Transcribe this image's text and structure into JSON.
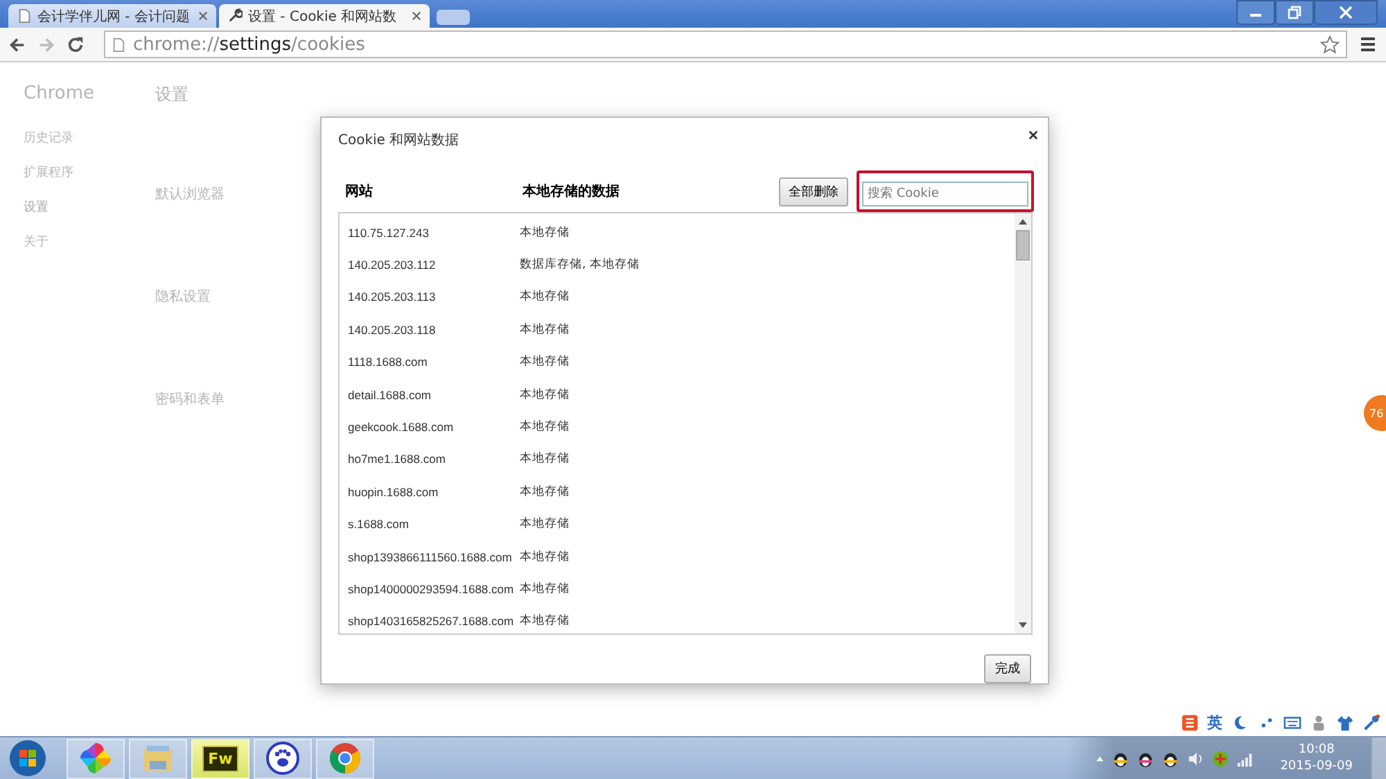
{
  "browser": {
    "tabs": [
      {
        "title": "会计学伴儿网 - 会计问题",
        "selected": false
      },
      {
        "title": "设置 - Cookie 和网站数",
        "selected": true
      }
    ],
    "address": {
      "scheme": "chrome://",
      "host": "settings",
      "path": "/cookies"
    }
  },
  "background_page": {
    "brand": "Chrome",
    "nav": [
      {
        "label": "历史记录",
        "selected": false
      },
      {
        "label": "扩展程序",
        "selected": false
      },
      {
        "label": "设置",
        "selected": true
      },
      {
        "label": "关于",
        "selected": false
      }
    ],
    "title": "设置",
    "sections": [
      "默认浏览器",
      "隐私设置",
      "密码和表单"
    ]
  },
  "dialog": {
    "title": "Cookie 和网站数据",
    "columns": [
      "网站",
      "本地存储的数据"
    ],
    "remove_all": "全部删除",
    "search": {
      "placeholder": "搜索 Cookie",
      "highlighted": true
    },
    "rows": [
      {
        "site": "110.75.127.243",
        "data": "本地存储"
      },
      {
        "site": "140.205.203.112",
        "data": "数据库存储, 本地存储"
      },
      {
        "site": "140.205.203.113",
        "data": "本地存储"
      },
      {
        "site": "140.205.203.118",
        "data": "本地存储"
      },
      {
        "site": "1118.1688.com",
        "data": "本地存储"
      },
      {
        "site": "detail.1688.com",
        "data": "本地存储"
      },
      {
        "site": "geekcook.1688.com",
        "data": "本地存储"
      },
      {
        "site": "ho7me1.1688.com",
        "data": "本地存储"
      },
      {
        "site": "huopin.1688.com",
        "data": "本地存储"
      },
      {
        "site": "s.1688.com",
        "data": "本地存储"
      },
      {
        "site": "shop1393866111560.1688.com",
        "data": "本地存储"
      },
      {
        "site": "shop1400000293594.1688.com",
        "data": "本地存储"
      },
      {
        "site": "shop1403165825267.1688.com",
        "data": "本地存储"
      }
    ],
    "done": "完成"
  },
  "float_badge": "76",
  "ime_toolbar": {
    "mode": "英"
  },
  "taskbar": {
    "apps": [
      {
        "kind": "pinwheel",
        "selected": false
      },
      {
        "kind": "folder",
        "selected": false
      },
      {
        "kind": "fw",
        "label": "Fw",
        "selected": true
      },
      {
        "kind": "paw",
        "selected": false
      },
      {
        "kind": "chrome",
        "selected": false
      }
    ]
  },
  "clock": {
    "time": "10:08",
    "date": "2015-09-09"
  }
}
